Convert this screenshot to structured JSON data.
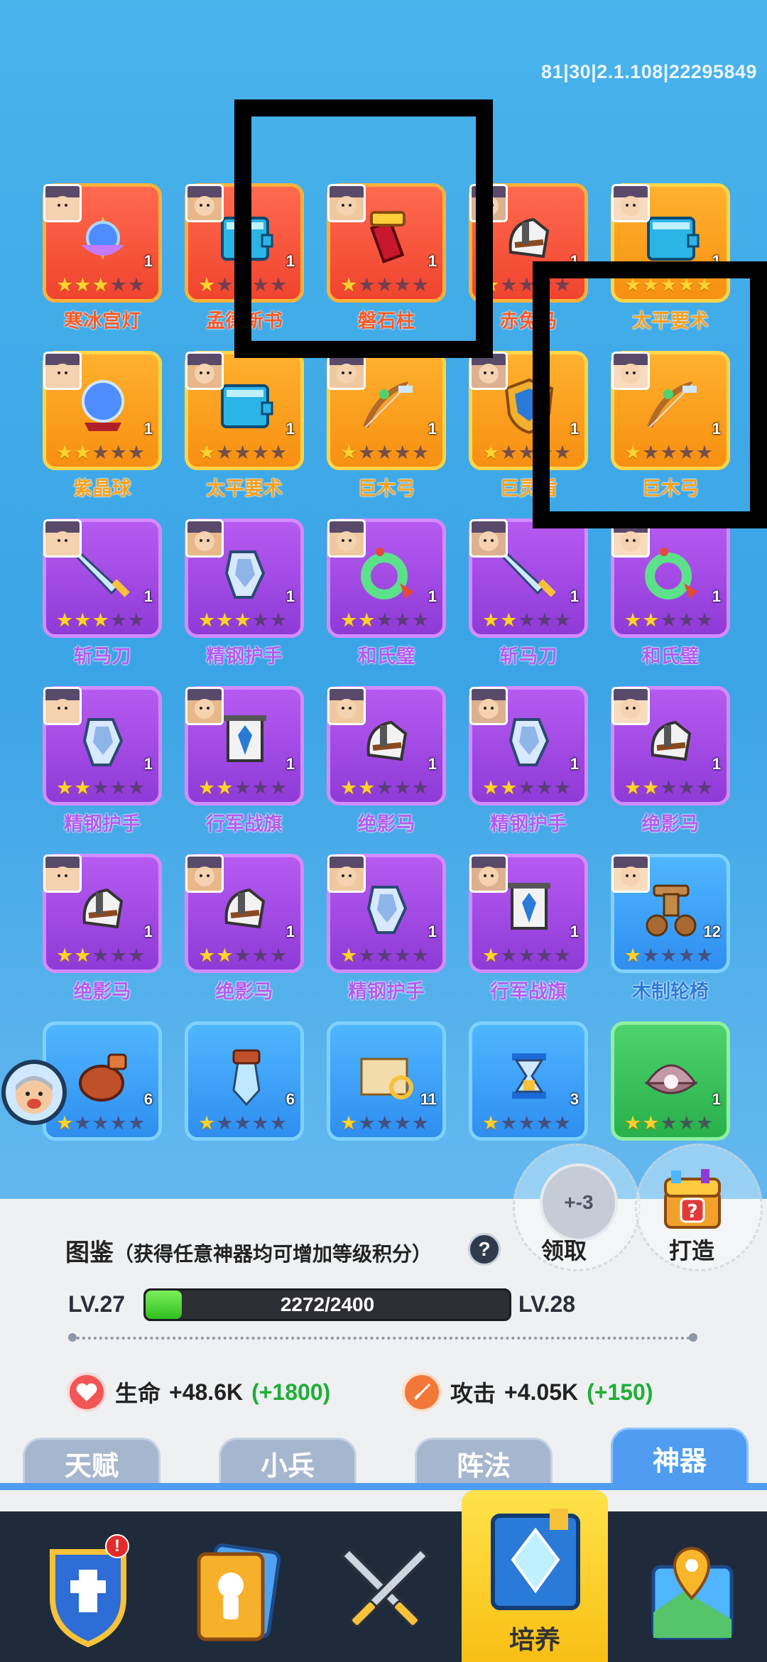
{
  "version_text": "81|30|2.1.108|22295849",
  "items": [
    {
      "name": "寒冰宫灯",
      "count": "1",
      "stars": 3,
      "rarity": "red",
      "icon": "lotus-lamp-icon"
    },
    {
      "name": "孟德新书",
      "count": "1",
      "stars": 1,
      "rarity": "red",
      "icon": "book-icon"
    },
    {
      "name": "磐石柱",
      "count": "1",
      "stars": 1,
      "rarity": "red",
      "icon": "pillar-icon"
    },
    {
      "name": "赤兔马",
      "count": "1",
      "stars": 1,
      "rarity": "red",
      "icon": "horse-icon"
    },
    {
      "name": "太平要术",
      "count": "1",
      "stars": 5,
      "rarity": "orange",
      "icon": "book-icon"
    },
    {
      "name": "紫晶球",
      "count": "1",
      "stars": 2,
      "rarity": "orange",
      "icon": "crystal-ball-icon"
    },
    {
      "name": "太平要术",
      "count": "1",
      "stars": 1,
      "rarity": "orange",
      "icon": "book-icon"
    },
    {
      "name": "巨木弓",
      "count": "1",
      "stars": 1,
      "rarity": "orange",
      "icon": "bow-icon"
    },
    {
      "name": "巨灵盾",
      "count": "1",
      "stars": 1,
      "rarity": "orange",
      "icon": "shield-icon"
    },
    {
      "name": "巨木弓",
      "count": "1",
      "stars": 1,
      "rarity": "orange",
      "icon": "bow-icon"
    },
    {
      "name": "斩马刀",
      "count": "1",
      "stars": 3,
      "rarity": "purple",
      "icon": "sword-icon"
    },
    {
      "name": "精钢护手",
      "count": "1",
      "stars": 3,
      "rarity": "purple",
      "icon": "gauntlet-icon"
    },
    {
      "name": "和氏璧",
      "count": "1",
      "stars": 2,
      "rarity": "purple",
      "icon": "jade-ring-icon"
    },
    {
      "name": "斩马刀",
      "count": "1",
      "stars": 2,
      "rarity": "purple",
      "icon": "sword-icon"
    },
    {
      "name": "和氏璧",
      "count": "1",
      "stars": 2,
      "rarity": "purple",
      "icon": "jade-ring-icon"
    },
    {
      "name": "精钢护手",
      "count": "1",
      "stars": 2,
      "rarity": "purple",
      "icon": "gauntlet-icon"
    },
    {
      "name": "行军战旗",
      "count": "1",
      "stars": 2,
      "rarity": "purple",
      "icon": "banner-icon"
    },
    {
      "name": "绝影马",
      "count": "1",
      "stars": 2,
      "rarity": "purple",
      "icon": "horse-icon"
    },
    {
      "name": "精钢护手",
      "count": "1",
      "stars": 2,
      "rarity": "purple",
      "icon": "gauntlet-icon"
    },
    {
      "name": "绝影马",
      "count": "1",
      "stars": 2,
      "rarity": "purple",
      "icon": "horse-icon"
    },
    {
      "name": "绝影马",
      "count": "1",
      "stars": 2,
      "rarity": "purple",
      "icon": "horse-icon"
    },
    {
      "name": "绝影马",
      "count": "1",
      "stars": 2,
      "rarity": "purple",
      "icon": "horse-icon"
    },
    {
      "name": "精钢护手",
      "count": "1",
      "stars": 1,
      "rarity": "purple",
      "icon": "gauntlet-icon"
    },
    {
      "name": "行军战旗",
      "count": "1",
      "stars": 1,
      "rarity": "purple",
      "icon": "banner-icon"
    },
    {
      "name": "木制轮椅",
      "count": "12",
      "stars": 1,
      "rarity": "blue",
      "icon": "wheelchair-icon"
    },
    {
      "name": "",
      "count": "6",
      "stars": 1,
      "rarity": "blue",
      "icon": "pouch-icon"
    },
    {
      "name": "",
      "count": "6",
      "stars": 1,
      "rarity": "blue",
      "icon": "crystal-icon"
    },
    {
      "name": "",
      "count": "11",
      "stars": 1,
      "rarity": "blue",
      "icon": "map-scroll-icon"
    },
    {
      "name": "",
      "count": "3",
      "stars": 1,
      "rarity": "blue",
      "icon": "hourglass-icon"
    },
    {
      "name": "",
      "count": "1",
      "stars": 2,
      "rarity": "green",
      "icon": "pearl-shell-icon"
    }
  ],
  "panel": {
    "claim_value": "+-3",
    "claim_label": "领取",
    "forge_label": "打造",
    "codex_title": "图鉴",
    "codex_subtitle": "（获得任意神器均可增加等级积分）",
    "help_icon": "?",
    "level_current": "LV.27",
    "level_next": "LV.28",
    "progress_text": "2272/2400",
    "progress_value": 0.1,
    "stat_hp_label": "生命",
    "stat_hp_value": "+48.6K",
    "stat_hp_bonus": "(+1800)",
    "stat_atk_label": "攻击",
    "stat_atk_value": "+4.05K",
    "stat_atk_bonus": "(+150)"
  },
  "tabs": [
    "天赋",
    "小兵",
    "阵法",
    "神器"
  ],
  "active_tab": "神器",
  "bottom_nav": {
    "active_label": "培养",
    "badge": "!"
  },
  "colors": {
    "bg_blue": "#3aa4e6",
    "active_tab": "#4f9cf0",
    "nav_active": "#ffd233",
    "green_bonus": "#1fae37"
  }
}
